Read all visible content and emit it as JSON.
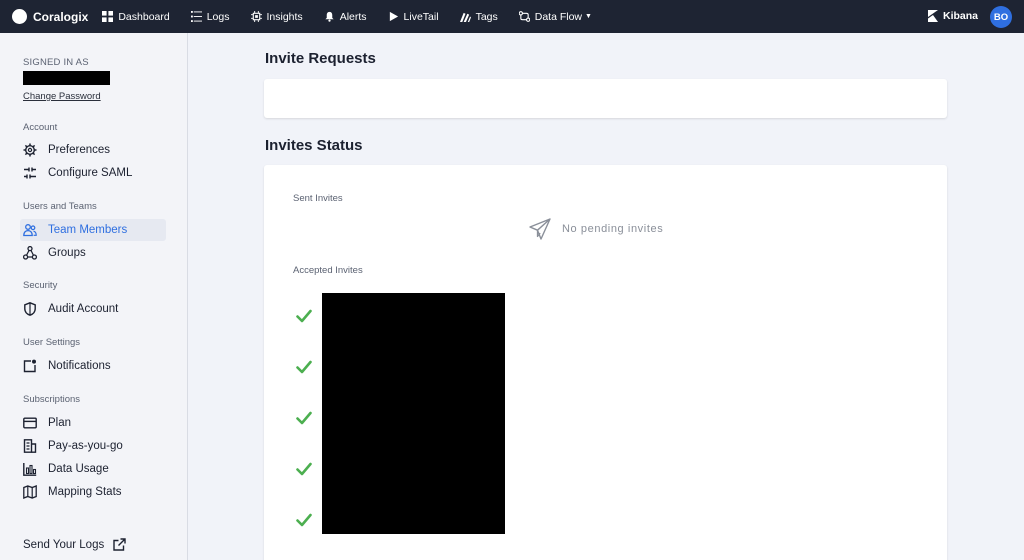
{
  "topbar": {
    "brand": "Coralogix",
    "nav": [
      {
        "label": "Dashboard",
        "icon": "dashboard-icon"
      },
      {
        "label": "Logs",
        "icon": "logs-icon"
      },
      {
        "label": "Insights",
        "icon": "insights-icon"
      },
      {
        "label": "Alerts",
        "icon": "bell-icon"
      },
      {
        "label": "LiveTail",
        "icon": "play-icon"
      },
      {
        "label": "Tags",
        "icon": "tags-icon"
      },
      {
        "label": "Data Flow",
        "icon": "data-flow-icon"
      }
    ],
    "kibana_label": "Kibana",
    "avatar_initials": "BO"
  },
  "sidebar": {
    "signed_in_label": "SIGNED IN AS",
    "change_password": "Change Password",
    "sections": {
      "account": {
        "label": "Account",
        "items": [
          "Preferences",
          "Configure SAML"
        ]
      },
      "users_teams": {
        "label": "Users and Teams",
        "items": [
          "Team Members",
          "Groups"
        ]
      },
      "security": {
        "label": "Security",
        "items": [
          "Audit Account"
        ]
      },
      "user_settings": {
        "label": "User Settings",
        "items": [
          "Notifications"
        ]
      },
      "subscriptions": {
        "label": "Subscriptions",
        "items": [
          "Plan",
          "Pay-as-you-go",
          "Data Usage",
          "Mapping Stats"
        ]
      }
    },
    "active_item": "Team Members",
    "send_logs": "Send Your Logs"
  },
  "main": {
    "invite_requests_title": "Invite Requests",
    "invites_status_title": "Invites Status",
    "sent_invites_label": "Sent Invites",
    "no_pending_text": "No pending invites",
    "accepted_invites_label": "Accepted Invites",
    "accepted_count": 5
  },
  "colors": {
    "topbar": "#1e2433",
    "accent": "#2f6fe0",
    "check": "#4caf50"
  }
}
